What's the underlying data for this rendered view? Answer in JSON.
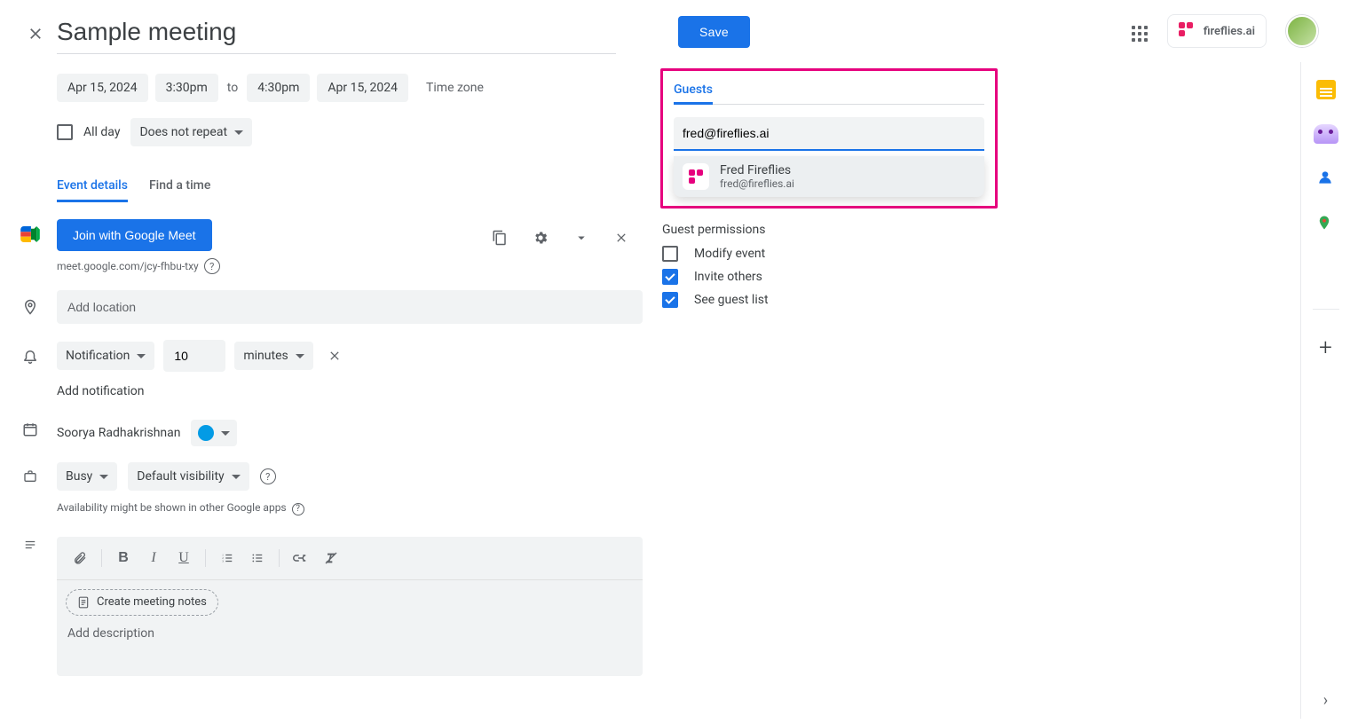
{
  "header": {
    "title": "Sample meeting",
    "save": "Save",
    "extension": "fireflies.ai"
  },
  "datetime": {
    "start_date": "Apr 15, 2024",
    "start_time": "3:30pm",
    "to": "to",
    "end_time": "4:30pm",
    "end_date": "Apr 15, 2024",
    "timezone": "Time zone",
    "all_day": "All day",
    "repeat": "Does not repeat"
  },
  "tabs": {
    "details": "Event details",
    "find_time": "Find a time"
  },
  "meet": {
    "join": "Join with Google Meet",
    "link": "meet.google.com/jcy-fhbu-txy"
  },
  "location": {
    "placeholder": "Add location"
  },
  "notification": {
    "type": "Notification",
    "value": "10",
    "unit": "minutes",
    "add": "Add notification"
  },
  "calendar": {
    "owner": "Soorya Radhakrishnan"
  },
  "availability": {
    "busy": "Busy",
    "visibility": "Default visibility",
    "hint": "Availability might be shown in other Google apps"
  },
  "editor": {
    "create_notes": "Create meeting notes",
    "placeholder": "Add description"
  },
  "guests": {
    "title": "Guests",
    "input": "fred@fireflies.ai",
    "suggestion": {
      "name": "Fred Fireflies",
      "email": "fred@fireflies.ai"
    },
    "perm_title": "Guest permissions",
    "perm_modify": "Modify event",
    "perm_invite": "Invite others",
    "perm_see": "See guest list"
  }
}
